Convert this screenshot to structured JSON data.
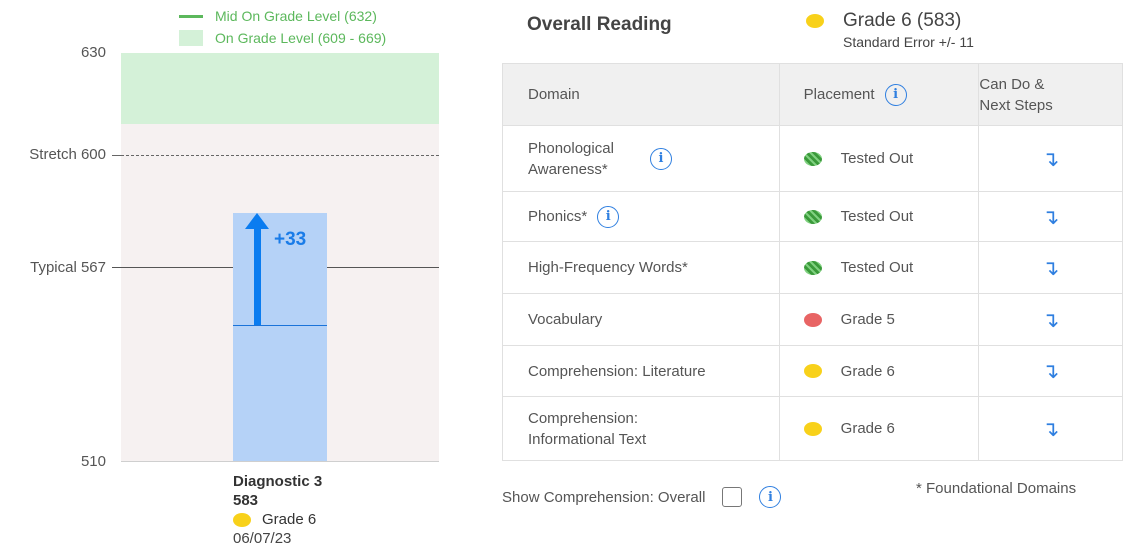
{
  "legend": {
    "mid_on_grade": "Mid On Grade Level (632)",
    "on_grade": "On Grade Level (609 - 669)"
  },
  "axis": {
    "top": "630",
    "stretch": "Stretch 600",
    "typical": "Typical 567",
    "bottom": "510"
  },
  "growth": "+33",
  "diagnostic": {
    "title": "Diagnostic 3",
    "score": "583",
    "grade": "Grade 6",
    "date": "06/07/23"
  },
  "overall": {
    "title": "Overall Reading",
    "grade": "Grade 6 (583)",
    "std_error": "Standard Error +/- 11"
  },
  "table": {
    "headers": {
      "domain": "Domain",
      "placement": "Placement",
      "can_do_line1": "Can Do &",
      "can_do_line2": "Next Steps"
    },
    "rows": [
      {
        "domain": "Phonological Awareness*",
        "placement": "Tested Out"
      },
      {
        "domain": "Phonics*",
        "placement": "Tested Out"
      },
      {
        "domain": "High-Frequency Words*",
        "placement": "Tested Out"
      },
      {
        "domain": "Vocabulary",
        "placement": "Grade 5"
      },
      {
        "domain": "Comprehension: Literature",
        "placement": "Grade 6"
      },
      {
        "domain": "Comprehension: Informational Text",
        "placement": "Grade 6"
      }
    ],
    "arrow_symbol": "↴"
  },
  "footer": {
    "show_comprehension": "Show Comprehension: Overall",
    "foundational_note": "*  Foundational Domains"
  },
  "icons": {
    "info": "i"
  },
  "colors": {
    "on_grade_band": "#d4f1d8",
    "mid_on_grade_line": "#5cb85c",
    "score_bar": "#b5d2f7",
    "growth_arrow": "#0a7cf0",
    "grade_on_level_dot": "#f8d11a",
    "grade_below_dot": "#e86464",
    "tested_out_dot": "#3a9a3a",
    "link": "#2f7fe0"
  }
}
